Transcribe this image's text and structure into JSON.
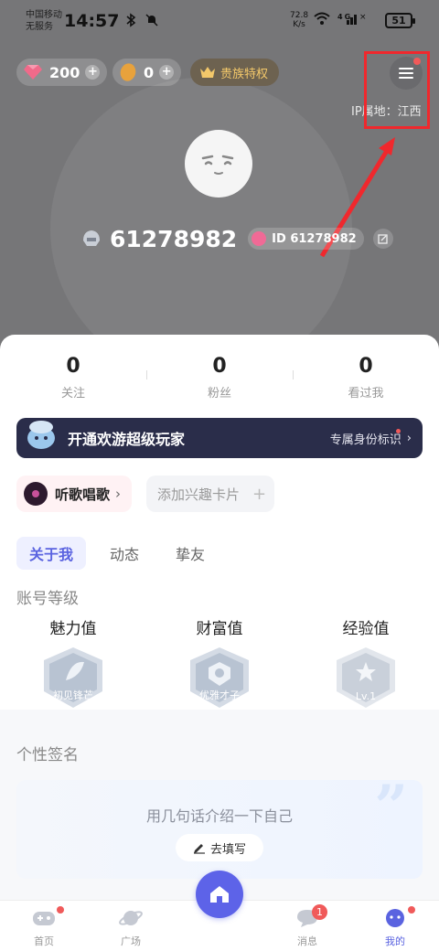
{
  "status_bar": {
    "carrier_line1": "中国移动",
    "carrier_line2": "无服务",
    "time": "14:57",
    "net_speed": "72.8",
    "net_unit": "K/s",
    "battery": "51"
  },
  "header": {
    "gems": "200",
    "beans": "0",
    "vip_label": "贵族特权",
    "ip_location": "IP属地：江西"
  },
  "profile": {
    "username": "61278982",
    "id_label": "ID 61278982"
  },
  "stats": [
    {
      "value": "0",
      "label": "关注"
    },
    {
      "value": "0",
      "label": "粉丝"
    },
    {
      "value": "0",
      "label": "看过我"
    }
  ],
  "vip_banner": {
    "title": "开通欢游超级玩家",
    "subtitle": "专属身份标识",
    "chevron": "›"
  },
  "interests": {
    "tag": "听歌唱歌",
    "tag_chevron": "›",
    "add_label": "添加兴趣卡片",
    "add_plus": "+"
  },
  "tabs": [
    "关于我",
    "动态",
    "挚友"
  ],
  "account_level": {
    "title": "账号等级",
    "items": [
      {
        "label": "魅力值",
        "badge": "初见锋芒",
        "color": "#a7b4c6"
      },
      {
        "label": "财富值",
        "badge": "优雅才子",
        "color": "#a9b6c9"
      },
      {
        "label": "经验值",
        "badge": "Lv.1",
        "color": "#c4cbd6"
      }
    ]
  },
  "signature": {
    "title": "个性签名",
    "hint": "用几句话介绍一下自己",
    "button": "去填写"
  },
  "bottom_nav": {
    "home": "首页",
    "square": "广场",
    "messages": "消息",
    "messages_badge": "1",
    "mine": "我的"
  },
  "colors": {
    "accent": "#5a63e0",
    "annotation": "#f0282d"
  }
}
